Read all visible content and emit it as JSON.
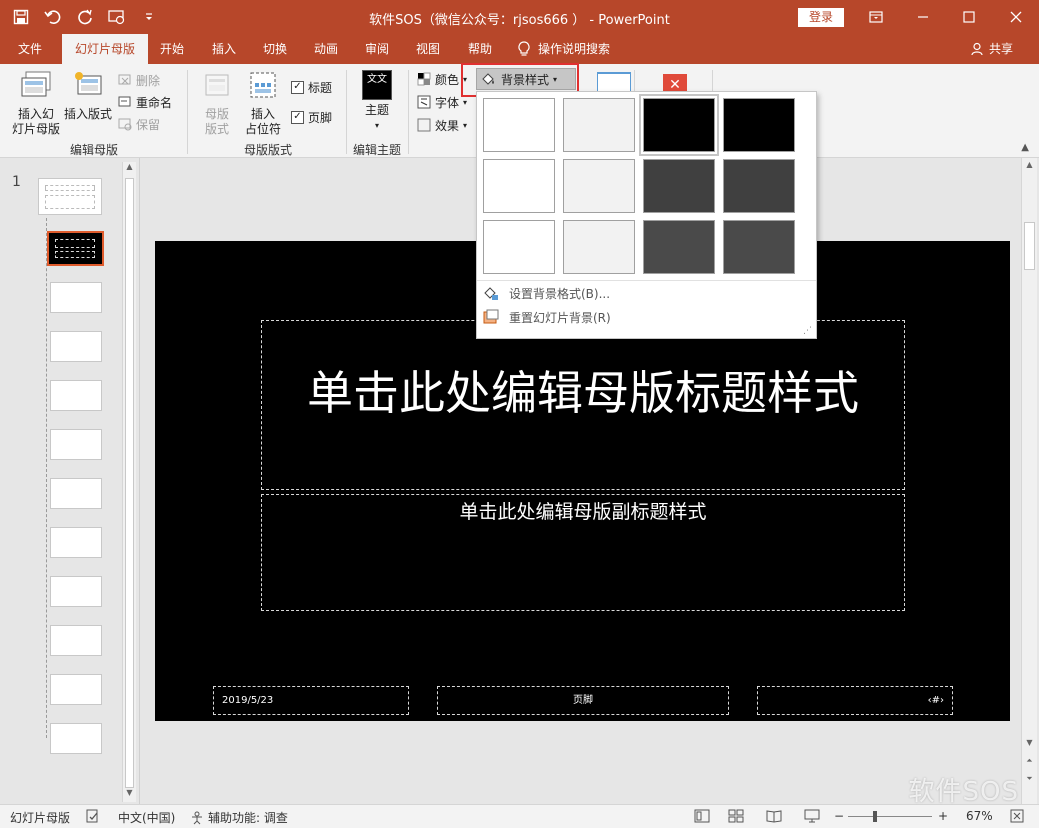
{
  "window": {
    "title": "软件SOS（微信公众号：rjsos666 ） -  PowerPoint",
    "login_label": "登录"
  },
  "tabs": [
    {
      "label": "文件"
    },
    {
      "label": "幻灯片母版"
    },
    {
      "label": "开始"
    },
    {
      "label": "插入"
    },
    {
      "label": "切换"
    },
    {
      "label": "动画"
    },
    {
      "label": "审阅"
    },
    {
      "label": "视图"
    },
    {
      "label": "帮助"
    },
    {
      "label": "操作说明搜索"
    }
  ],
  "share_label": "共享",
  "ribbon": {
    "edit_master": {
      "insert_master": "插入幻\n灯片母版",
      "insert_layout": "插入版式",
      "delete": "删除",
      "rename": "重命名",
      "preserve": "保留",
      "group_label": "编辑母版"
    },
    "master_layout": {
      "master_layout_btn": "母版\n版式",
      "insert_placeholder": "插入\n占位符",
      "title_check": "标题",
      "footer_check": "页脚",
      "group_label": "母版版式"
    },
    "edit_theme": {
      "themes": "主题",
      "themes_icon_text": "文文",
      "group_label": "编辑主题"
    },
    "background": {
      "colors": "颜色",
      "fonts": "字体",
      "effects": "效果",
      "background_styles": "背景样式"
    }
  },
  "dropdown": {
    "swatch_colors": [
      [
        "#ffffff",
        "#f2f2f2",
        "#000000",
        "#000000"
      ],
      [
        "#ffffff",
        "#f2f2f2",
        "#404040",
        "#404040"
      ],
      [
        "#ffffff",
        "#f2f2f2",
        "#4a4a4a",
        "#4a4a4a"
      ]
    ],
    "format_background": "设置背景格式(B)...",
    "reset_background": "重置幻灯片背景(R)"
  },
  "thumbnails": {
    "slide_number": "1"
  },
  "slide": {
    "title": "单击此处编辑母版标题样式",
    "subtitle": "单击此处编辑母版副标题样式",
    "date": "2019/5/23",
    "footer": "页脚",
    "number": "‹#›"
  },
  "statusbar": {
    "view_name": "幻灯片母版",
    "language": "中文(中国)",
    "accessibility": "辅助功能: 调查",
    "zoom": "67%",
    "zoom_level_fraction": 0.67
  },
  "watermark": "软件SOS",
  "colors": {
    "accent": "#b7472a",
    "highlight": "#e03030",
    "selected_thumb_border": "#e05c2d"
  }
}
